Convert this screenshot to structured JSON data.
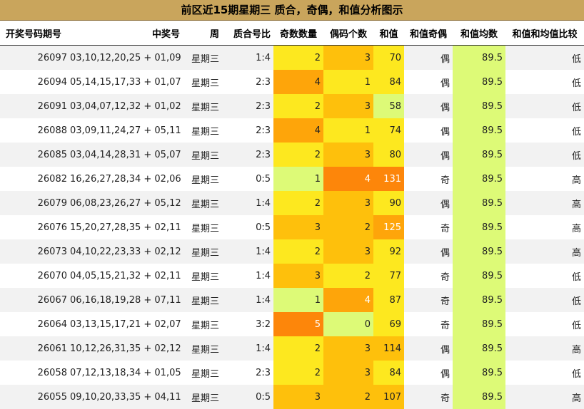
{
  "title": "前区近15期星期三 质合，奇偶，和值分析图示",
  "headers": [
    "开奖号码期号",
    "中奖号",
    "周",
    "质合号比",
    "奇数数量",
    "偶码个数",
    "和值",
    "和值奇偶",
    "和值均数",
    "和值和均值比较"
  ],
  "colors": {
    "header_bg": "#c9a55c",
    "zebra": "#f2f2f2",
    "avg_bg": "#ddfa77",
    "heat": {
      "1": "#ddfa77",
      "2": "#fde81f",
      "3": "#fec00c",
      "4": "#fea50a",
      "5": "#fd860a"
    }
  },
  "rows": [
    {
      "issue": "26097",
      "numbers": "03,10,12,20,25 + 01,09",
      "week": "星期三",
      "ratio": "1:4",
      "odd": "2",
      "even": "3",
      "sum": "70",
      "sum_parity": "偶",
      "avg": "89.5",
      "compare": "低",
      "odd_color": "#fde81f",
      "even_color": "#fec00c",
      "sum_color": "#fde81f"
    },
    {
      "issue": "26094",
      "numbers": "05,14,15,17,33 + 01,07",
      "week": "星期三",
      "ratio": "2:3",
      "odd": "4",
      "even": "1",
      "sum": "84",
      "sum_parity": "偶",
      "avg": "89.5",
      "compare": "低",
      "odd_color": "#fea50a",
      "even_color": "#fde81f",
      "sum_color": "#fde81f"
    },
    {
      "issue": "26091",
      "numbers": "03,04,07,12,32 + 01,02",
      "week": "星期三",
      "ratio": "2:3",
      "odd": "2",
      "even": "3",
      "sum": "58",
      "sum_parity": "偶",
      "avg": "89.5",
      "compare": "低",
      "odd_color": "#fde81f",
      "even_color": "#fec00c",
      "sum_color": "#ddfa77"
    },
    {
      "issue": "26088",
      "numbers": "03,09,11,24,27 + 05,11",
      "week": "星期三",
      "ratio": "2:3",
      "odd": "4",
      "even": "1",
      "sum": "74",
      "sum_parity": "偶",
      "avg": "89.5",
      "compare": "低",
      "odd_color": "#fea50a",
      "even_color": "#fde81f",
      "sum_color": "#fde81f"
    },
    {
      "issue": "26085",
      "numbers": "03,04,14,28,31 + 05,07",
      "week": "星期三",
      "ratio": "2:3",
      "odd": "2",
      "even": "3",
      "sum": "80",
      "sum_parity": "偶",
      "avg": "89.5",
      "compare": "低",
      "odd_color": "#fde81f",
      "even_color": "#fec00c",
      "sum_color": "#fde81f"
    },
    {
      "issue": "26082",
      "numbers": "16,26,27,28,34 + 02,06",
      "week": "星期三",
      "ratio": "0:5",
      "odd": "1",
      "even": "4",
      "sum": "131",
      "sum_parity": "奇",
      "avg": "89.5",
      "compare": "高",
      "odd_color": "#ddfa77",
      "even_color": "#fd860a",
      "sum_color": "#fd860a"
    },
    {
      "issue": "26079",
      "numbers": "06,08,23,26,27 + 05,12",
      "week": "星期三",
      "ratio": "1:4",
      "odd": "2",
      "even": "3",
      "sum": "90",
      "sum_parity": "偶",
      "avg": "89.5",
      "compare": "高",
      "odd_color": "#fde81f",
      "even_color": "#fec00c",
      "sum_color": "#fde81f"
    },
    {
      "issue": "26076",
      "numbers": "15,20,27,28,35 + 02,11",
      "week": "星期三",
      "ratio": "0:5",
      "odd": "3",
      "even": "2",
      "sum": "125",
      "sum_parity": "奇",
      "avg": "89.5",
      "compare": "高",
      "odd_color": "#fec00c",
      "even_color": "#fec00c",
      "sum_color": "#fea50a"
    },
    {
      "issue": "26073",
      "numbers": "04,10,22,23,33 + 02,12",
      "week": "星期三",
      "ratio": "1:4",
      "odd": "2",
      "even": "3",
      "sum": "92",
      "sum_parity": "偶",
      "avg": "89.5",
      "compare": "高",
      "odd_color": "#fde81f",
      "even_color": "#fec00c",
      "sum_color": "#fde81f"
    },
    {
      "issue": "26070",
      "numbers": "04,05,15,21,32 + 02,11",
      "week": "星期三",
      "ratio": "1:4",
      "odd": "3",
      "even": "2",
      "sum": "77",
      "sum_parity": "奇",
      "avg": "89.5",
      "compare": "低",
      "odd_color": "#fec00c",
      "even_color": "#fde81f",
      "sum_color": "#fde81f"
    },
    {
      "issue": "26067",
      "numbers": "06,16,18,19,28 + 07,11",
      "week": "星期三",
      "ratio": "1:4",
      "odd": "1",
      "even": "4",
      "sum": "87",
      "sum_parity": "奇",
      "avg": "89.5",
      "compare": "低",
      "odd_color": "#ddfa77",
      "even_color": "#fea50a",
      "sum_color": "#fde81f"
    },
    {
      "issue": "26064",
      "numbers": "03,13,15,17,21 + 02,07",
      "week": "星期三",
      "ratio": "3:2",
      "odd": "5",
      "even": "0",
      "sum": "69",
      "sum_parity": "奇",
      "avg": "89.5",
      "compare": "低",
      "odd_color": "#fd860a",
      "even_color": "#ddfa77",
      "sum_color": "#fde81f"
    },
    {
      "issue": "26061",
      "numbers": "10,12,26,31,35 + 02,12",
      "week": "星期三",
      "ratio": "1:4",
      "odd": "2",
      "even": "3",
      "sum": "114",
      "sum_parity": "偶",
      "avg": "89.5",
      "compare": "高",
      "odd_color": "#fde81f",
      "even_color": "#fec00c",
      "sum_color": "#fec00c"
    },
    {
      "issue": "26058",
      "numbers": "07,12,13,18,34 + 01,05",
      "week": "星期三",
      "ratio": "2:3",
      "odd": "2",
      "even": "3",
      "sum": "84",
      "sum_parity": "偶",
      "avg": "89.5",
      "compare": "低",
      "odd_color": "#fde81f",
      "even_color": "#fec00c",
      "sum_color": "#fde81f"
    },
    {
      "issue": "26055",
      "numbers": "09,10,20,33,35 + 04,11",
      "week": "星期三",
      "ratio": "0:5",
      "odd": "3",
      "even": "2",
      "sum": "107",
      "sum_parity": "奇",
      "avg": "89.5",
      "compare": "高",
      "odd_color": "#fec00c",
      "even_color": "#fec00c",
      "sum_color": "#fec00c"
    }
  ]
}
